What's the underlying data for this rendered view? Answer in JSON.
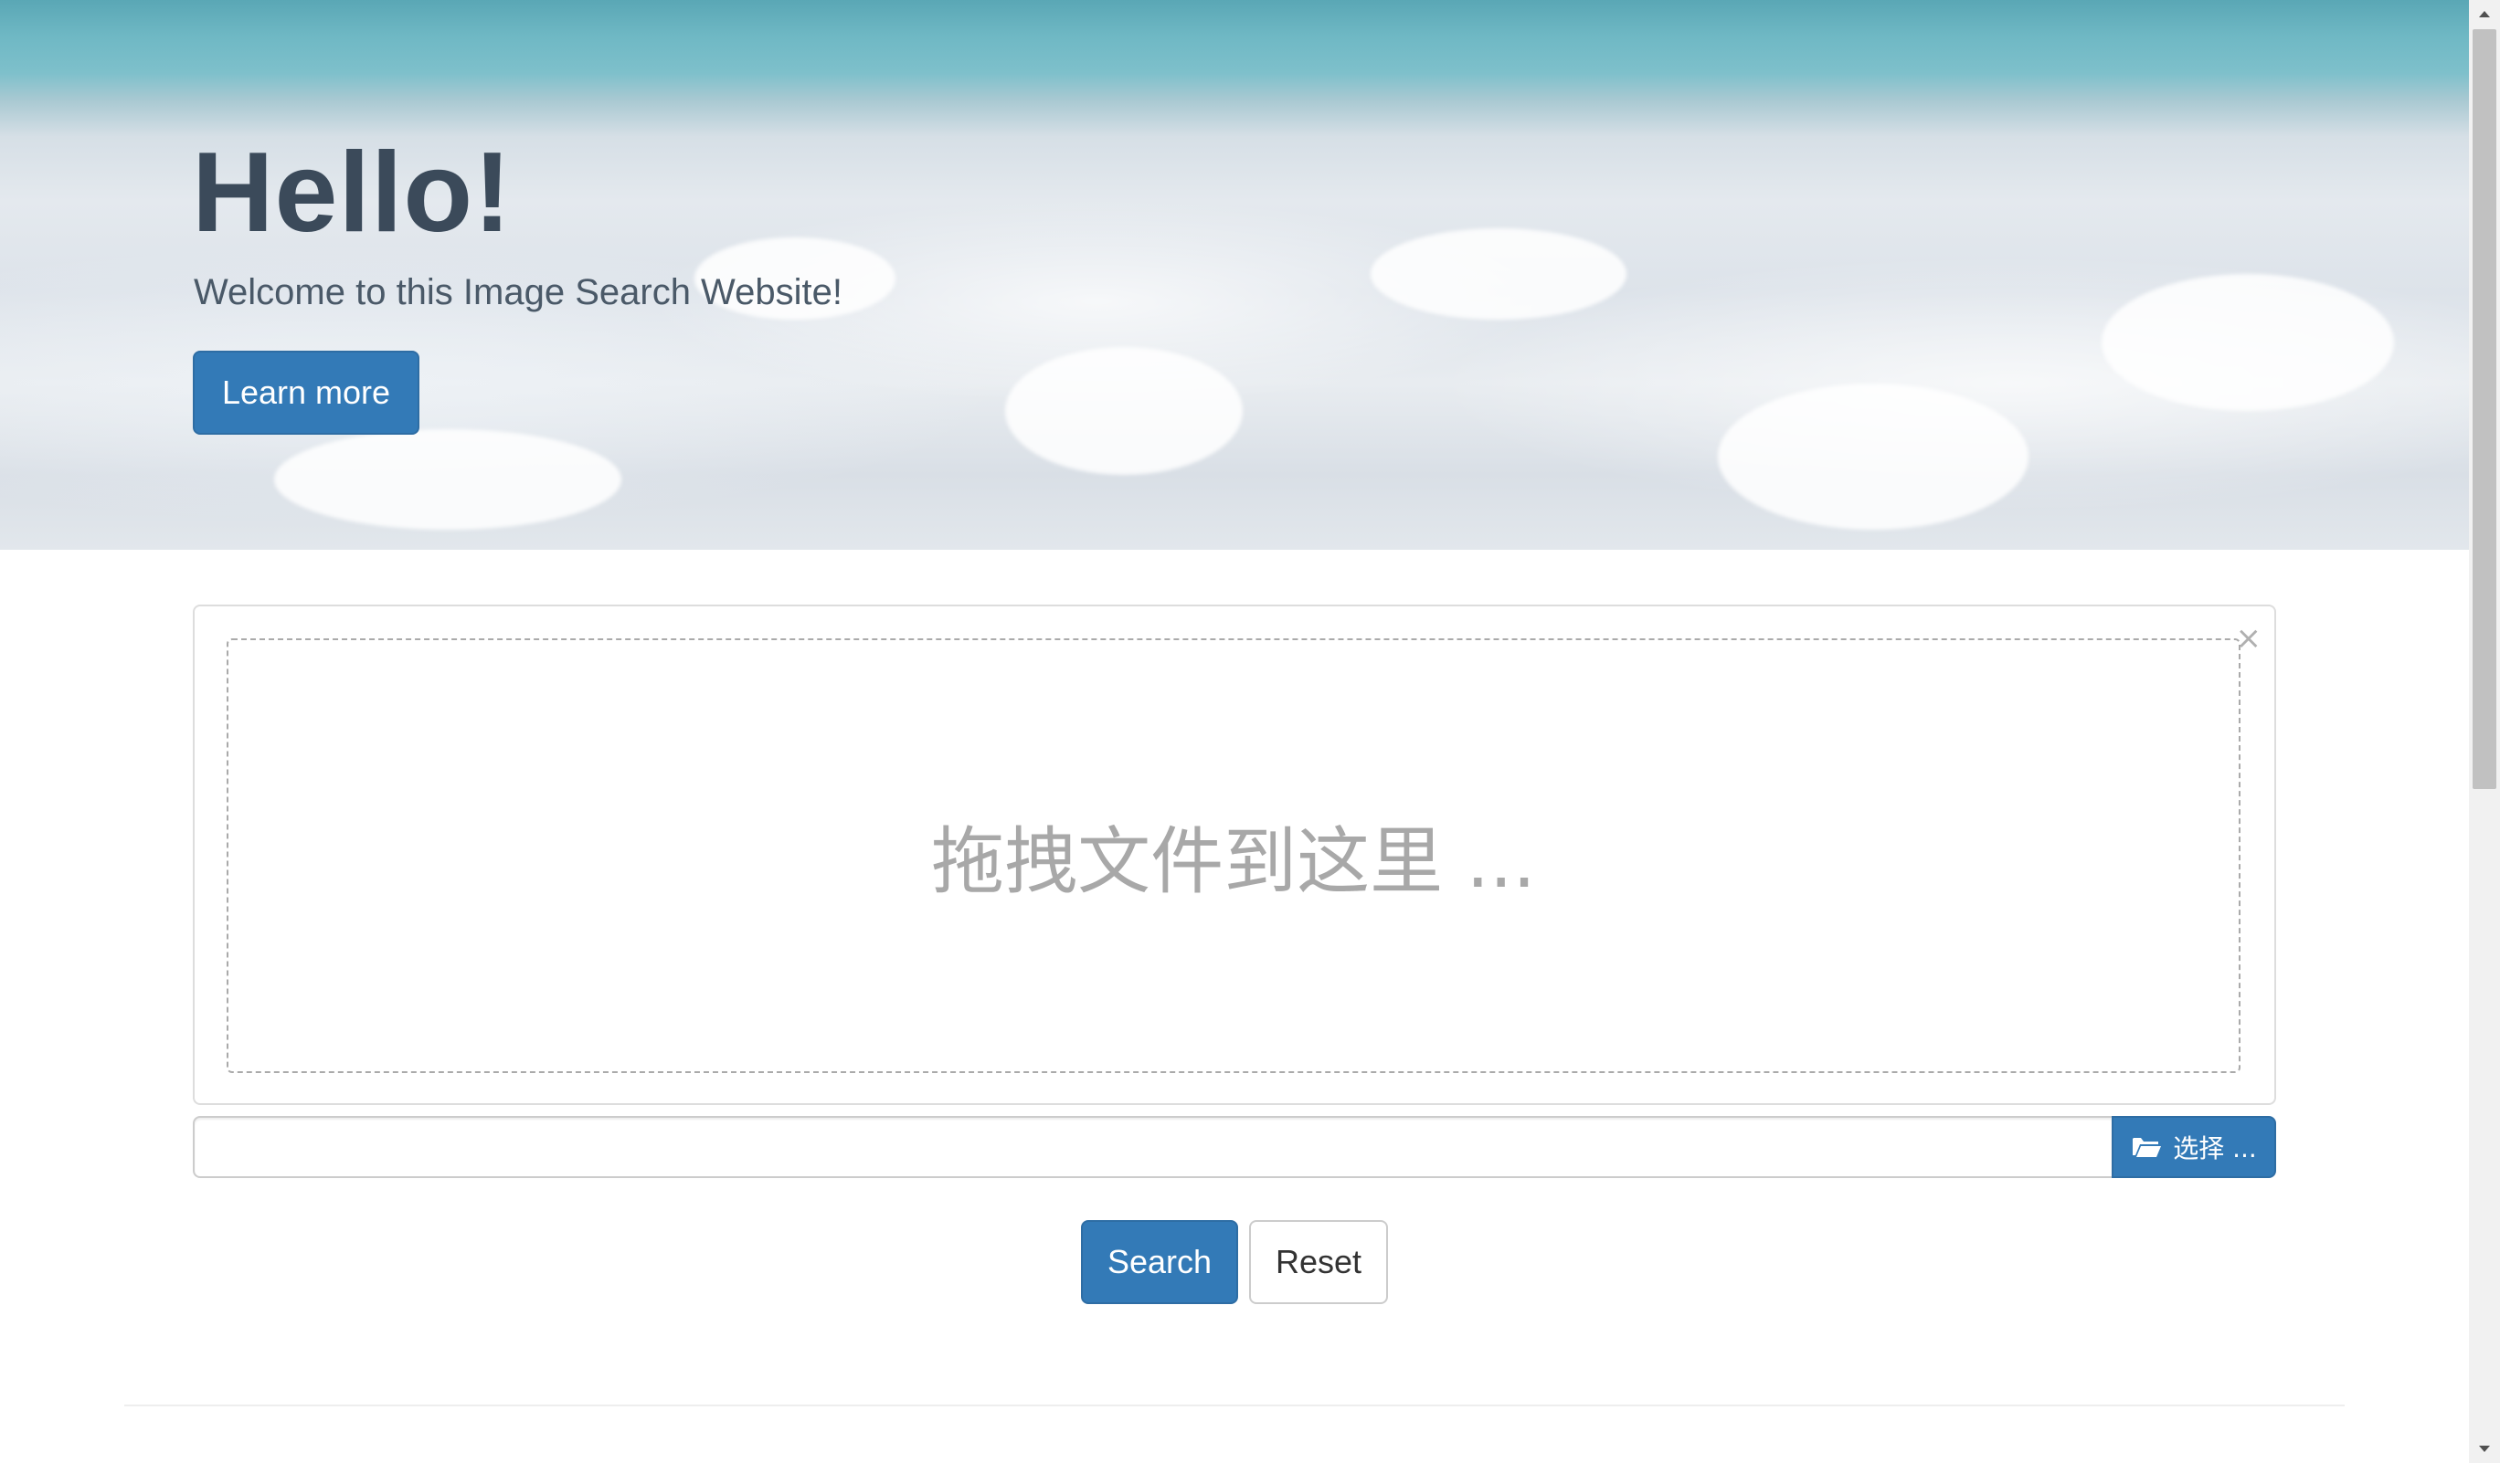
{
  "hero": {
    "title": "Hello!",
    "subtitle": "Welcome to this Image Search Website!",
    "learn_more_label": "Learn more"
  },
  "file_input": {
    "drop_text": "拖拽文件到这里 ...",
    "close_symbol": "×",
    "caption_value": "",
    "browse_label": "选择 ...",
    "browse_icon": "folder-open-icon"
  },
  "actions": {
    "search_label": "Search",
    "reset_label": "Reset"
  },
  "colors": {
    "primary": "#337ab7",
    "primary_border": "#2e6da4",
    "hero_text": "#3b4a5a",
    "drop_text": "#a8a8a8"
  }
}
